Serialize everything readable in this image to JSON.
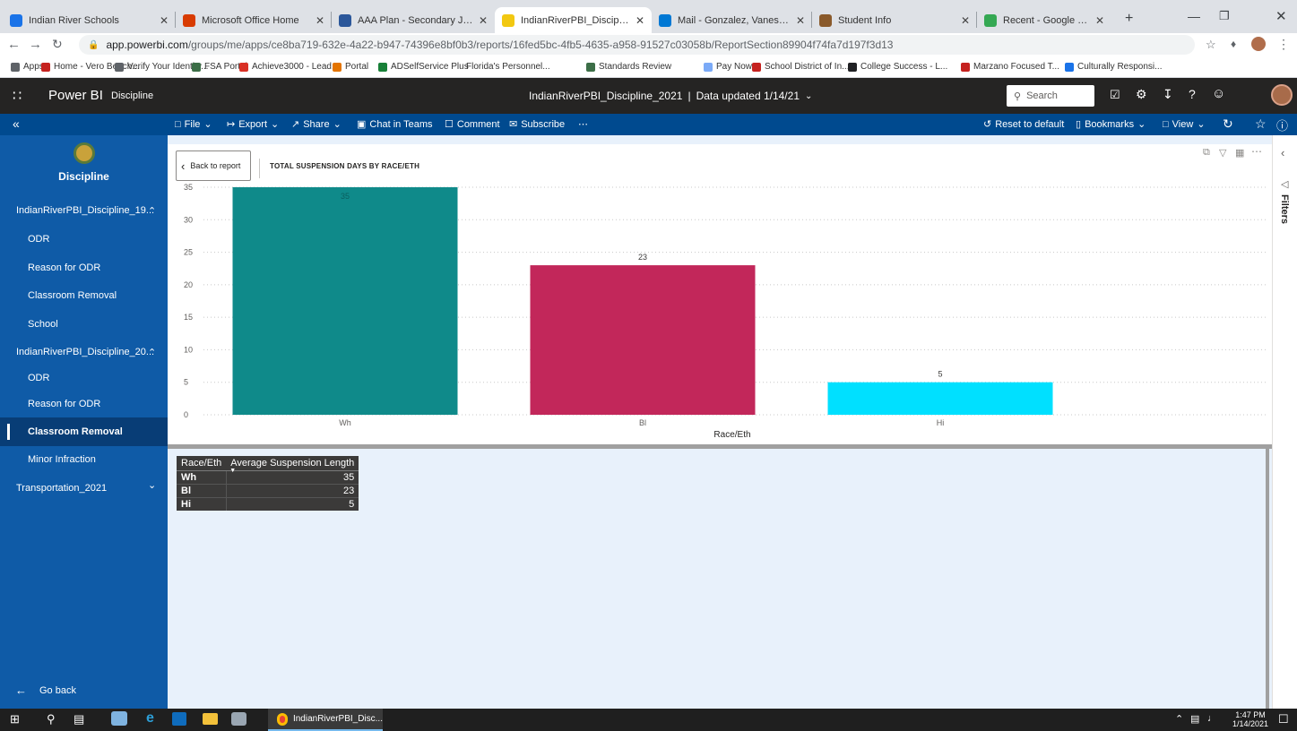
{
  "browser": {
    "tabs": [
      {
        "label": "Indian River Schools",
        "color": "#1a73e8"
      },
      {
        "label": "Microsoft Office Home",
        "color": "#d83b01"
      },
      {
        "label": "AAA Plan - Secondary January 15",
        "color": "#2b579a"
      },
      {
        "label": "IndianRiverPBI_Discipline_2021 -",
        "color": "#f2c811"
      },
      {
        "label": "Mail - Gonzalez, Vanessa - Outlo",
        "color": "#0078d4"
      },
      {
        "label": "Student Info",
        "color": "#8a5a2b"
      },
      {
        "label": "Recent - Google Drive",
        "color": "#34a853"
      }
    ],
    "url_host": "app.powerbi.com",
    "url_path": "/groups/me/apps/ce8ba719-632e-4a22-b947-74396e8bf0b3/reports/16fed5bc-4fb5-4635-a958-91527c03058b/ReportSection89904f74fa7d197f3d13",
    "bookmarks": [
      {
        "label": "Apps",
        "color": "#5f6368"
      },
      {
        "label": "Home - Vero Beach...",
        "color": "#c5221f"
      },
      {
        "label": "Verify Your Identity...",
        "color": "#5f6368"
      },
      {
        "label": "FSA Portal",
        "color": "#3c6e47"
      },
      {
        "label": "Achieve3000 - Lead...",
        "color": "#d93025"
      },
      {
        "label": "Portal",
        "color": "#e37400"
      },
      {
        "label": "ADSelfService Plus",
        "color": "#188038"
      },
      {
        "label": "Florida's Personnel...",
        "color": "#ffffff"
      },
      {
        "label": "Standards Review",
        "color": "#3c6e47"
      },
      {
        "label": "Pay Now",
        "color": "#7baaf7"
      },
      {
        "label": "School District of In...",
        "color": "#c5221f"
      },
      {
        "label": "College Success - L...",
        "color": "#202124"
      },
      {
        "label": "Marzano Focused T...",
        "color": "#c5221f"
      },
      {
        "label": "Culturally Responsi...",
        "color": "#1a73e8"
      }
    ]
  },
  "pbi_header": {
    "product": "Power BI",
    "app_name": "Discipline",
    "report_title": "IndianRiverPBI_Discipline_2021",
    "data_updated": "Data updated 1/14/21",
    "search_placeholder": "Search"
  },
  "toolbar": {
    "file": "File",
    "export": "Export",
    "share": "Share",
    "chat": "Chat in Teams",
    "comment": "Comment",
    "subscribe": "Subscribe",
    "reset": "Reset to default",
    "bookmarks": "Bookmarks",
    "view": "View"
  },
  "sidebar": {
    "title": "Discipline",
    "items": [
      {
        "label": "IndianRiverPBI_Discipline_19...",
        "kind": "group"
      },
      {
        "label": "ODR",
        "kind": "page"
      },
      {
        "label": "Reason for ODR",
        "kind": "page"
      },
      {
        "label": "Classroom Removal",
        "kind": "page"
      },
      {
        "label": "School",
        "kind": "page"
      },
      {
        "label": "IndianRiverPBI_Discipline_20...",
        "kind": "group"
      },
      {
        "label": "ODR",
        "kind": "page"
      },
      {
        "label": "Reason for ODR",
        "kind": "page"
      },
      {
        "label": "Classroom Removal",
        "kind": "page",
        "active": true
      },
      {
        "label": "Minor Infraction",
        "kind": "page"
      },
      {
        "label": "Transportation_2021",
        "kind": "group-collapsed"
      }
    ],
    "go_back": "Go back"
  },
  "visual": {
    "back_label": "Back to report",
    "title": "TOTAL SUSPENSION DAYS BY RACE/ETH"
  },
  "chart_data": {
    "type": "bar",
    "title": "TOTAL SUSPENSION DAYS BY RACE/ETH",
    "categories": [
      "Wh",
      "Bl",
      "Hi"
    ],
    "values": [
      35,
      23,
      5
    ],
    "bar_colors": [
      "#0f8a8a",
      "#c2275a",
      "#00e0ff"
    ],
    "xlabel": "Race/Eth",
    "ylabel": "",
    "ylim": [
      0,
      35
    ],
    "yticks": [
      0,
      5,
      10,
      15,
      20,
      25,
      30,
      35
    ],
    "grid": true
  },
  "table": {
    "headers": [
      "Race/Eth",
      "Average Suspension Length"
    ],
    "rows": [
      [
        "Wh",
        "35"
      ],
      [
        "Bl",
        "23"
      ],
      [
        "Hi",
        "5"
      ]
    ]
  },
  "filters_label": "Filters",
  "taskbar": {
    "active_app": "IndianRiverPBI_Disc...",
    "time": "1:47 PM",
    "date": "1/14/2021"
  }
}
